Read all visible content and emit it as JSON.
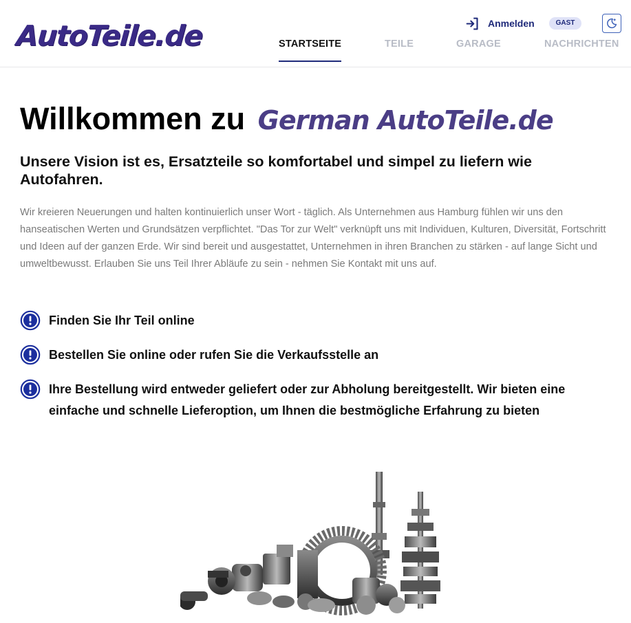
{
  "header": {
    "logo_text": "AutoTeile.de",
    "login_label": "Anmelden",
    "login_icon": "login-icon",
    "guest_badge": "GAST",
    "theme_toggle_icon": "moon-icon",
    "nav": [
      {
        "label": "STARTSEITE",
        "active": true
      },
      {
        "label": "TEILE",
        "active": false
      },
      {
        "label": "GARAGE",
        "active": false
      },
      {
        "label": "NACHRICHTEN",
        "active": false
      }
    ]
  },
  "main": {
    "title_prefix": "Willkommen zu",
    "title_brand": "German AutoTeile.de",
    "vision": "Unsere Vision ist es, Ersatzteile so komfortabel und simpel zu liefern wie Autofahren.",
    "intro": "Wir kreieren Neuerungen und halten kontinuierlich unser Wort - täglich. Als Unternehmen aus Hamburg fühlen wir uns den hanseatischen Werten und Grundsätzen verpflichtet. \"Das Tor zur Welt\" verknüpft uns mit Individuen, Kulturen, Diversität, Fortschritt und Ideen auf der ganzen Erde. Wir sind bereit und ausgestattet, Unternehmen in ihren Branchen zu stärken - auf lange Sicht und umweltbewusst. Erlauben Sie uns Teil Ihrer Abläufe zu sein - nehmen Sie Kontakt mit uns auf.",
    "features": [
      "Finden Sie Ihr Teil online",
      "Bestellen Sie online oder rufen Sie die Verkaufsstelle an",
      "Ihre Bestellung wird entweder geliefert oder zur Abholung bereitgestellt. Wir bieten eine einfache und schnelle Lieferoption, um Ihnen die bestmögliche Erfahrung zu bieten"
    ],
    "feature_icon": "exclamation-circle-icon",
    "image_subject": "car-parts-gears-image"
  },
  "colors": {
    "brand": "#3a2a86",
    "brand_inline": "#4b3e86",
    "accent": "#1f2a7a",
    "icon_blue": "#1c2f9e",
    "muted_text": "#7a7a7a",
    "nav_inactive": "#b8bcc6",
    "badge_bg": "#dfe2f7"
  }
}
